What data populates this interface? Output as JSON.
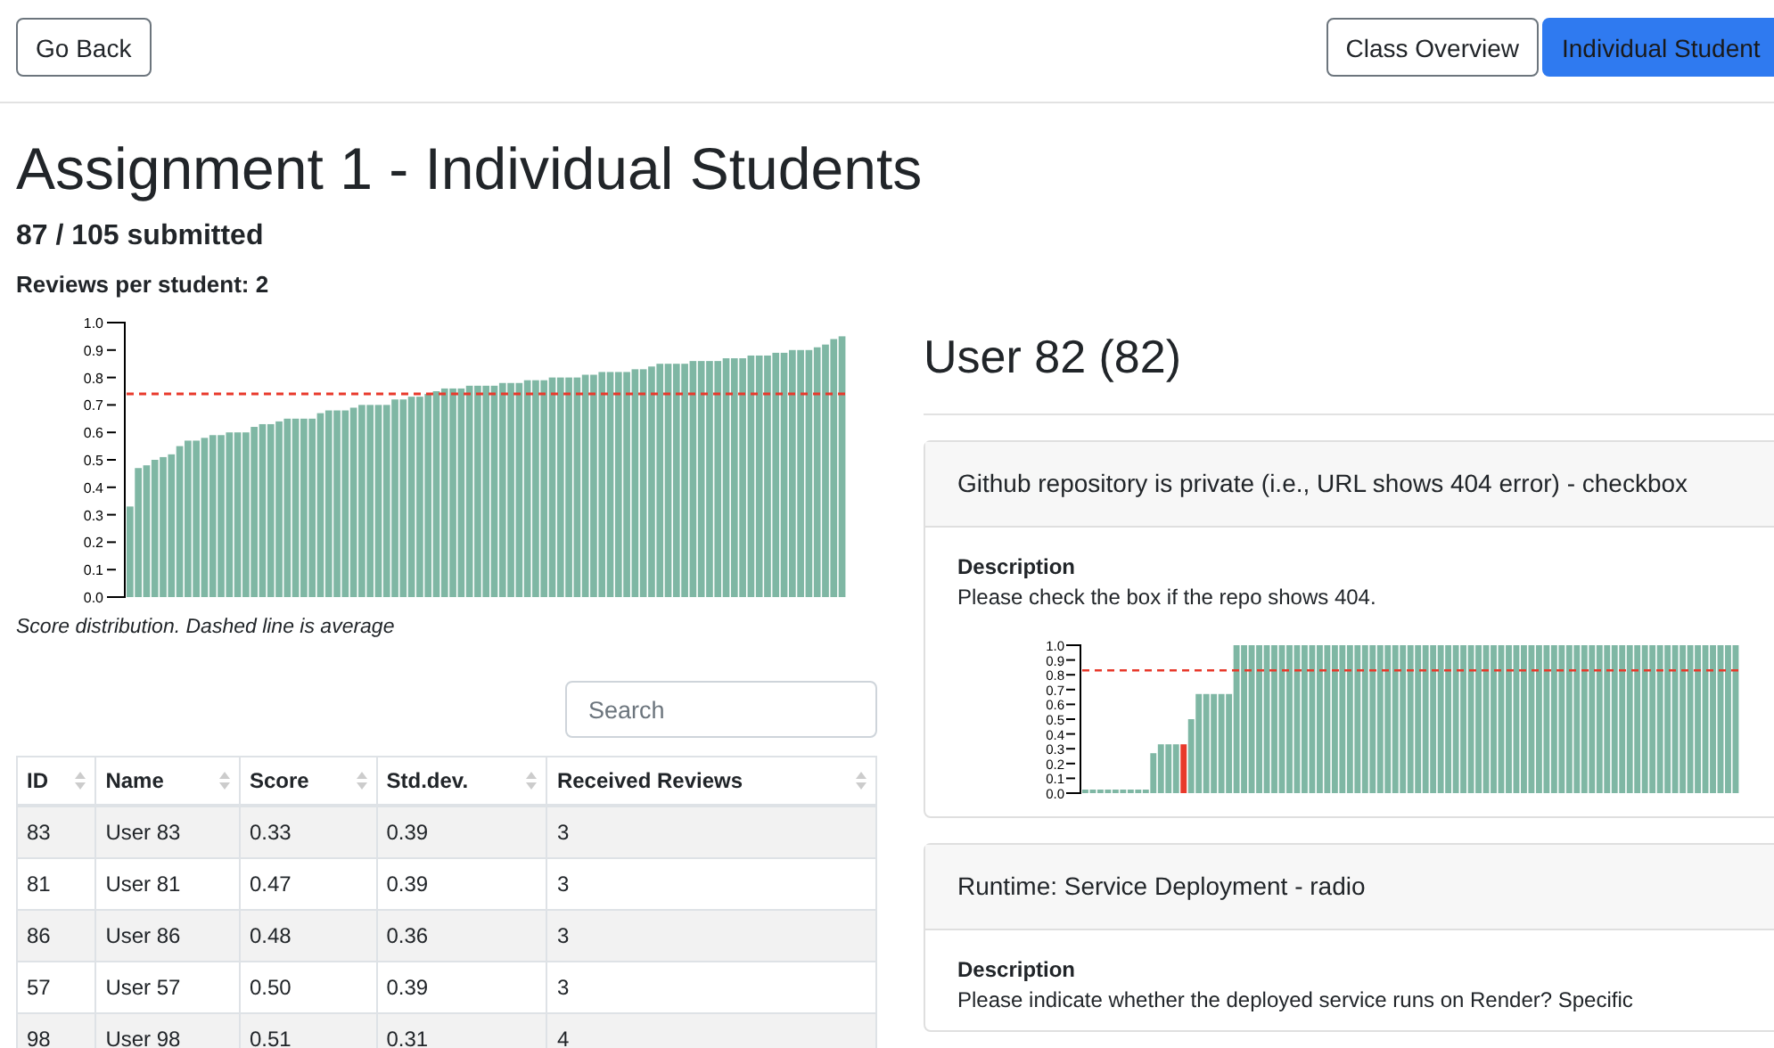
{
  "nav": {
    "back_button": "Go Back",
    "view_tabs": [
      {
        "label": "Class Overview",
        "selected": false
      },
      {
        "label": "Individual Student",
        "selected": true
      }
    ]
  },
  "title": "Assignment 1 - Individual Students",
  "submitted": "87 / 105 submitted",
  "reviews_per_student": "Reviews per student: 2",
  "score_chart": {
    "chart_data": {
      "type": "bar",
      "yticks": [
        {
          "value": 0,
          "label": "0.0"
        },
        {
          "value": 0.1,
          "label": "0.1"
        },
        {
          "value": 0.2,
          "label": "0.2"
        },
        {
          "value": 0.3,
          "label": "0.3"
        },
        {
          "value": 0.4,
          "label": "0.4"
        },
        {
          "value": 0.5,
          "label": "0.5"
        },
        {
          "value": 0.6,
          "label": "0.6"
        },
        {
          "value": 0.7,
          "label": "0.7"
        },
        {
          "value": 0.8,
          "label": "0.8"
        },
        {
          "value": 0.9,
          "label": "0.9"
        },
        {
          "value": 1,
          "label": "1.0"
        }
      ],
      "ylim": [
        0,
        1
      ],
      "values": [
        0.33,
        0.47,
        0.48,
        0.5,
        0.51,
        0.52,
        0.55,
        0.57,
        0.57,
        0.58,
        0.59,
        0.59,
        0.6,
        0.6,
        0.6,
        0.62,
        0.63,
        0.63,
        0.64,
        0.65,
        0.65,
        0.65,
        0.65,
        0.67,
        0.68,
        0.68,
        0.68,
        0.69,
        0.7,
        0.7,
        0.7,
        0.7,
        0.72,
        0.72,
        0.73,
        0.73,
        0.74,
        0.75,
        0.76,
        0.76,
        0.76,
        0.77,
        0.77,
        0.77,
        0.77,
        0.78,
        0.78,
        0.78,
        0.79,
        0.79,
        0.79,
        0.8,
        0.8,
        0.8,
        0.8,
        0.81,
        0.81,
        0.82,
        0.82,
        0.82,
        0.82,
        0.83,
        0.83,
        0.84,
        0.85,
        0.85,
        0.85,
        0.85,
        0.86,
        0.86,
        0.86,
        0.86,
        0.87,
        0.87,
        0.87,
        0.88,
        0.88,
        0.88,
        0.89,
        0.89,
        0.9,
        0.9,
        0.9,
        0.91,
        0.92,
        0.94,
        0.95
      ],
      "ref_lines": [
        {
          "axis": "y",
          "value": 0.74
        }
      ]
    },
    "caption": "Score distribution. Dashed line is average"
  },
  "search": {
    "placeholder": "Search"
  },
  "table": {
    "columns": [
      "ID",
      "Name",
      "Score",
      "Std.dev.",
      "Received Reviews"
    ],
    "rows": [
      [
        "83",
        "User 83",
        "0.33",
        "0.39",
        "3"
      ],
      [
        "81",
        "User 81",
        "0.47",
        "0.39",
        "3"
      ],
      [
        "86",
        "User 86",
        "0.48",
        "0.36",
        "3"
      ],
      [
        "57",
        "User 57",
        "0.50",
        "0.39",
        "3"
      ],
      [
        "98",
        "User 98",
        "0.51",
        "0.31",
        "4"
      ]
    ]
  },
  "student": {
    "heading": "User 82 (82)",
    "criteria": [
      {
        "title": "Github repository is private (i.e., URL shows 404 error) - checkbox",
        "description_label": "Description",
        "description": "Please check the box if the repo shows 404.",
        "chart_data": {
          "type": "bar",
          "yticks": [
            {
              "value": 0,
              "label": "0.0"
            },
            {
              "value": 0.1,
              "label": "0.1"
            },
            {
              "value": 0.2,
              "label": "0.2"
            },
            {
              "value": 0.3,
              "label": "0.3"
            },
            {
              "value": 0.4,
              "label": "0.4"
            },
            {
              "value": 0.5,
              "label": "0.5"
            },
            {
              "value": 0.6,
              "label": "0.6"
            },
            {
              "value": 0.7,
              "label": "0.7"
            },
            {
              "value": 0.8,
              "label": "0.8"
            },
            {
              "value": 0.9,
              "label": "0.9"
            },
            {
              "value": 1,
              "label": "1.0"
            }
          ],
          "ylim": [
            0,
            1
          ],
          "series": [
            {
              "color": "#7fb7a4",
              "values": [
                0,
                0,
                0,
                0,
                0,
                0,
                0,
                0,
                0,
                0.27,
                0.33,
                0.33,
                0.33,
                null,
                0.5,
                0.67,
                0.67,
                0.67,
                0.67,
                0.67,
                1,
                1,
                1,
                1,
                1,
                1,
                1,
                1,
                1,
                1,
                1,
                1,
                1,
                1,
                1,
                1,
                1,
                1,
                1,
                1,
                1,
                1,
                1,
                1,
                1,
                1,
                1,
                1,
                1,
                1,
                1,
                1,
                1,
                1,
                1,
                1,
                1,
                1,
                1,
                1,
                1,
                1,
                1,
                1,
                1,
                1,
                1,
                1,
                1,
                1,
                1,
                1,
                1,
                1,
                1,
                1,
                1,
                1,
                1,
                1,
                1,
                1,
                1,
                1,
                1,
                1,
                1
              ]
            },
            {
              "color": "#e8392b",
              "values": [
                null,
                null,
                null,
                null,
                null,
                null,
                null,
                null,
                null,
                null,
                null,
                null,
                null,
                0.33,
                null,
                null,
                null,
                null,
                null,
                null,
                null,
                null,
                null,
                null,
                null,
                null,
                null,
                null,
                null,
                null,
                null,
                null,
                null,
                null,
                null,
                null,
                null,
                null,
                null,
                null,
                null,
                null,
                null,
                null,
                null,
                null,
                null,
                null,
                null,
                null,
                null,
                null,
                null,
                null,
                null,
                null,
                null,
                null,
                null,
                null,
                null,
                null,
                null,
                null,
                null,
                null,
                null,
                null,
                null,
                null,
                null,
                null,
                null,
                null,
                null,
                null,
                null,
                null,
                null,
                null,
                null,
                null,
                null,
                null,
                null,
                null,
                null
              ]
            }
          ],
          "ref_lines": [
            {
              "axis": "y",
              "value": 0.83
            }
          ]
        }
      },
      {
        "title": "Runtime: Service Deployment - radio",
        "description_label": "Description",
        "description": "Please indicate whether the deployed service runs on Render? Specific"
      }
    ]
  }
}
